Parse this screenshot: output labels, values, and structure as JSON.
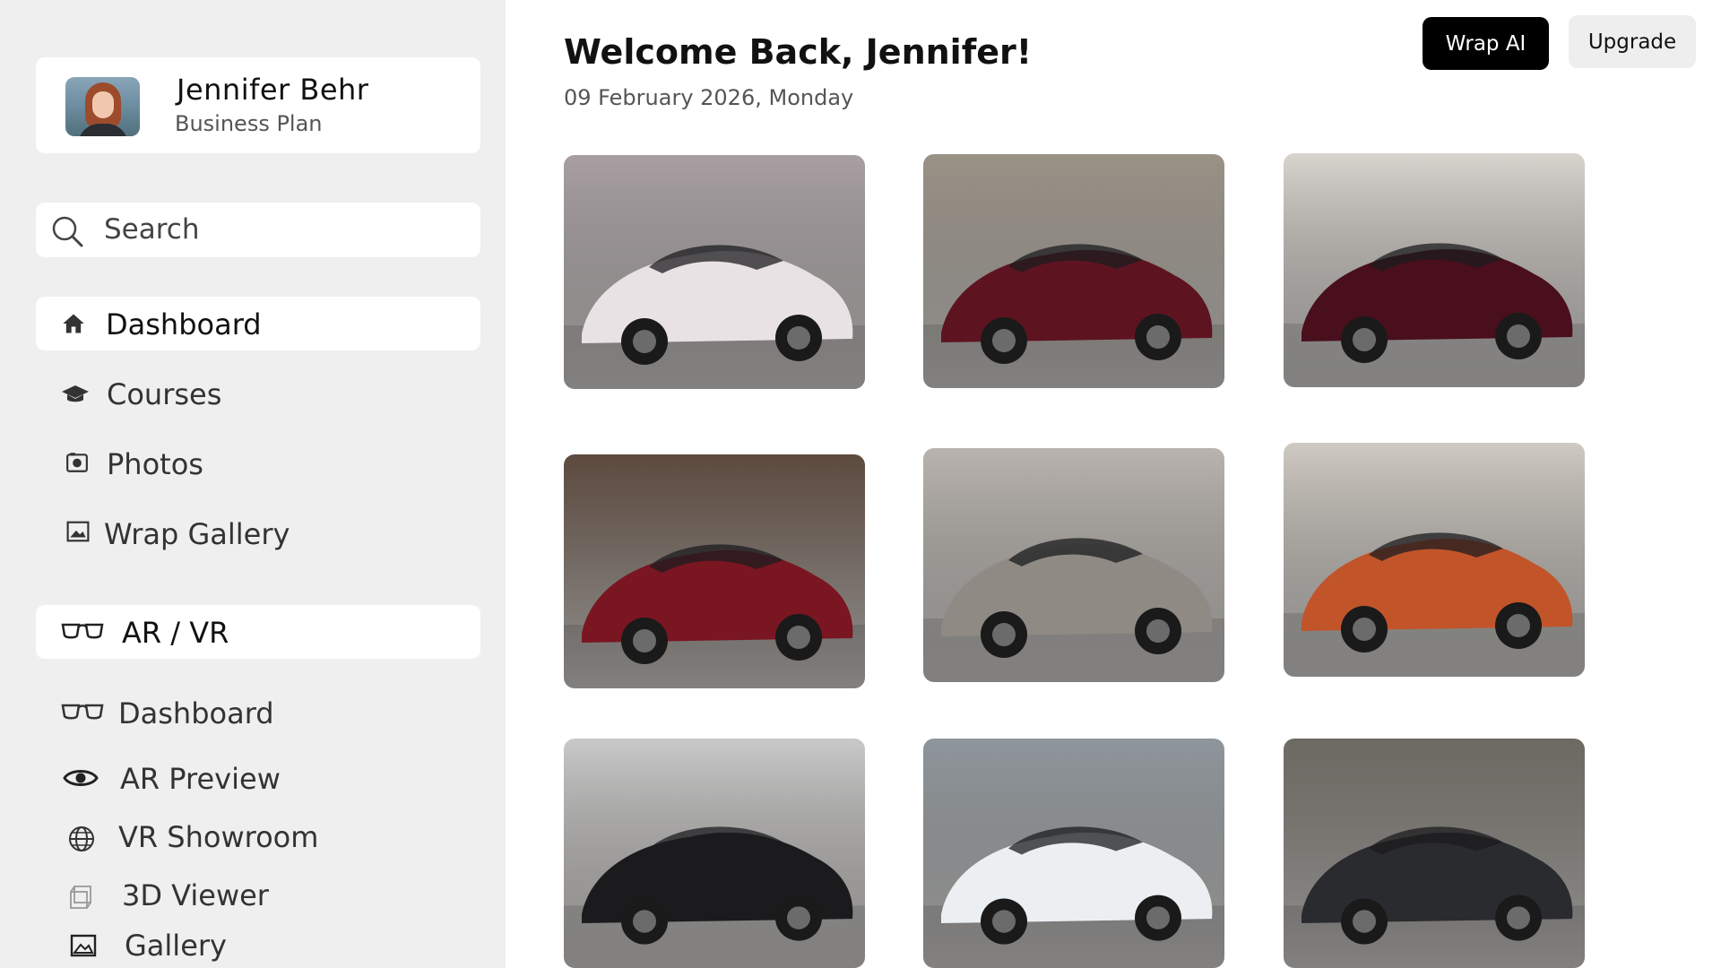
{
  "profile": {
    "name": "Jennifer Behr",
    "plan": "Business Plan"
  },
  "search": {
    "placeholder": "Search"
  },
  "nav": {
    "dashboard": "Dashboard",
    "courses": "Courses",
    "photos": "Photos",
    "wrap_gallery": "Wrap Gallery",
    "ar_vr": "AR / VR",
    "ar_dashboard": "Dashboard",
    "ar_preview": "AR Preview",
    "vr_showroom": "VR Showroom",
    "viewer_3d": "3D Viewer",
    "gallery": "Gallery"
  },
  "header": {
    "welcome": "Welcome Back, Jennifer!",
    "date": "09 February 2026, Monday",
    "wrap_ai_label": "Wrap AI",
    "upgrade_label": "Upgrade"
  },
  "gallery": [
    {
      "name": "white-pink-porsche-photo",
      "color": "#e9e2e4",
      "bg": "#a89fa3"
    },
    {
      "name": "burgundy-porsche-street-photo",
      "color": "#5e1420",
      "bg": "#9a9286"
    },
    {
      "name": "burgundy-ferrari-hotel-photo",
      "color": "#4a0f1c",
      "bg": "#d8d4ce"
    },
    {
      "name": "red-bmw-with-cat-photo",
      "color": "#7a1522",
      "bg": "#5d4a3e"
    },
    {
      "name": "chrome-tesla-concrete-photo",
      "color": "#8f8a84",
      "bg": "#b9b4ae"
    },
    {
      "name": "aurora-wrapped-van-photo",
      "color": "#c2542a",
      "bg": "#cfcac2"
    },
    {
      "name": "black-tesla-cat-ears-photo",
      "color": "#1b1b1d",
      "bg": "#c9c9c9"
    },
    {
      "name": "white-car-black-stripes-photo",
      "color": "#eceff1",
      "bg": "#8e969c"
    },
    {
      "name": "matte-black-tesla-expo-photo",
      "color": "#2a2b2e",
      "bg": "#6d6a63"
    }
  ]
}
